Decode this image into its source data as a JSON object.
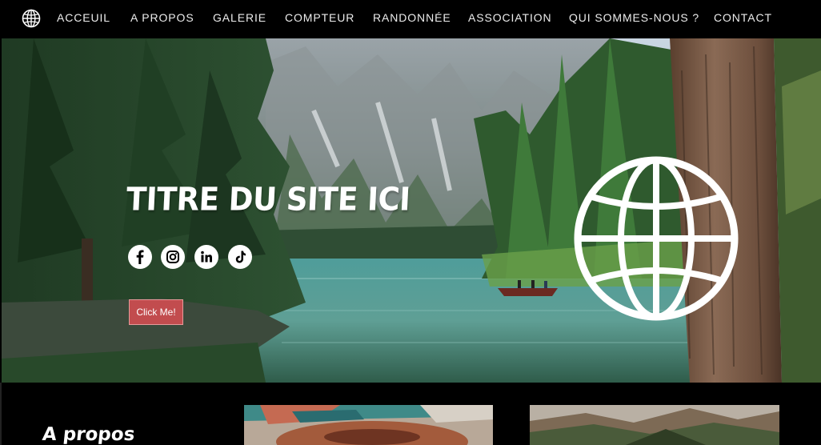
{
  "nav": {
    "items": [
      "ACCEUIL",
      "A PROPOS",
      "GALERIE",
      "COMPTEUR",
      "RANDONNÉE",
      "ASSOCIATION",
      "QUI SOMMES-NOUS ?",
      "CONTACT"
    ],
    "logo_icon": "globe-icon"
  },
  "hero": {
    "title": "TITRE DU SITE ICI",
    "cta_label": "Click Me!",
    "socials": [
      {
        "name": "facebook-icon",
        "glyph": "f"
      },
      {
        "name": "instagram-icon",
        "glyph": ""
      },
      {
        "name": "linkedin-icon",
        "glyph": "in"
      },
      {
        "name": "tiktok-icon",
        "glyph": "♪"
      }
    ],
    "globe_icon": "globe-icon"
  },
  "about": {
    "title": "A propos"
  },
  "colors": {
    "nav_bg": "#000000",
    "nav_text": "#ececec",
    "accent": "#c24c4e"
  }
}
